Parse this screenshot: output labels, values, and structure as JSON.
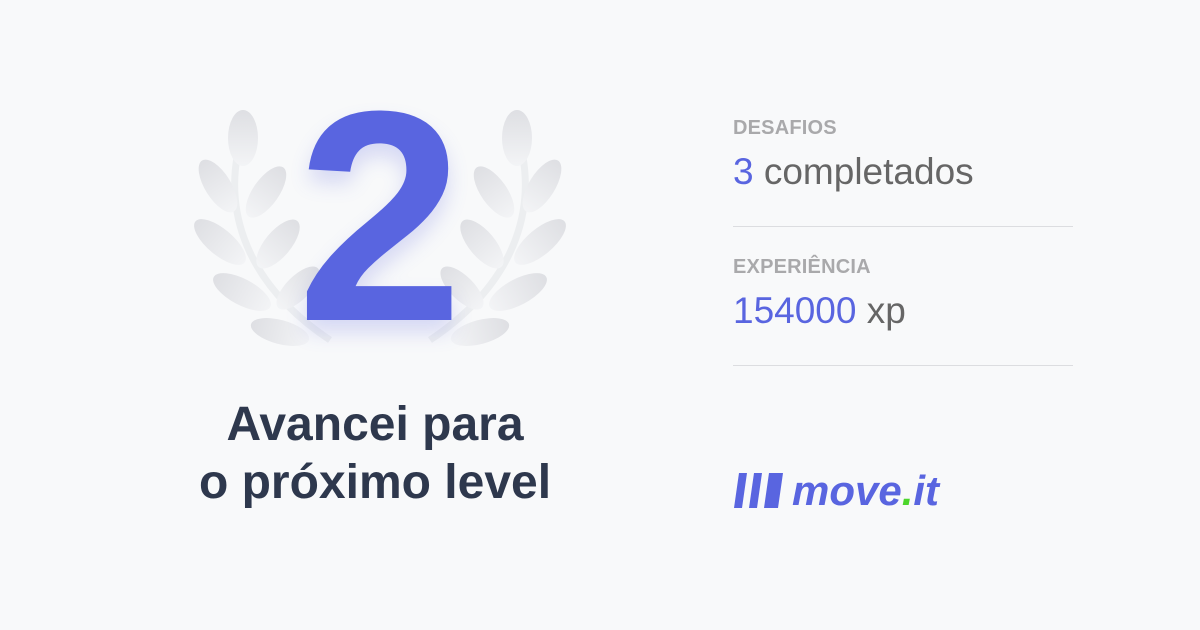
{
  "level": {
    "number": "2",
    "headline_line1": "Avancei para",
    "headline_line2": "o próximo level"
  },
  "stats": {
    "challenges": {
      "label": "DESAFIOS",
      "value": "3",
      "unit": "completados"
    },
    "experience": {
      "label": "EXPERIÊNCIA",
      "value": "154000",
      "unit": "xp"
    }
  },
  "logo": {
    "text_main": "move",
    "text_dot": ".",
    "text_suffix": "it",
    "icon": "brand-stripes-icon"
  },
  "colors": {
    "accent": "#5965e0",
    "heading": "#2e384d",
    "label": "#a9a9ab",
    "text": "#666666",
    "logo_dot": "#4cd62b",
    "laurel": "#e6e7ea"
  }
}
